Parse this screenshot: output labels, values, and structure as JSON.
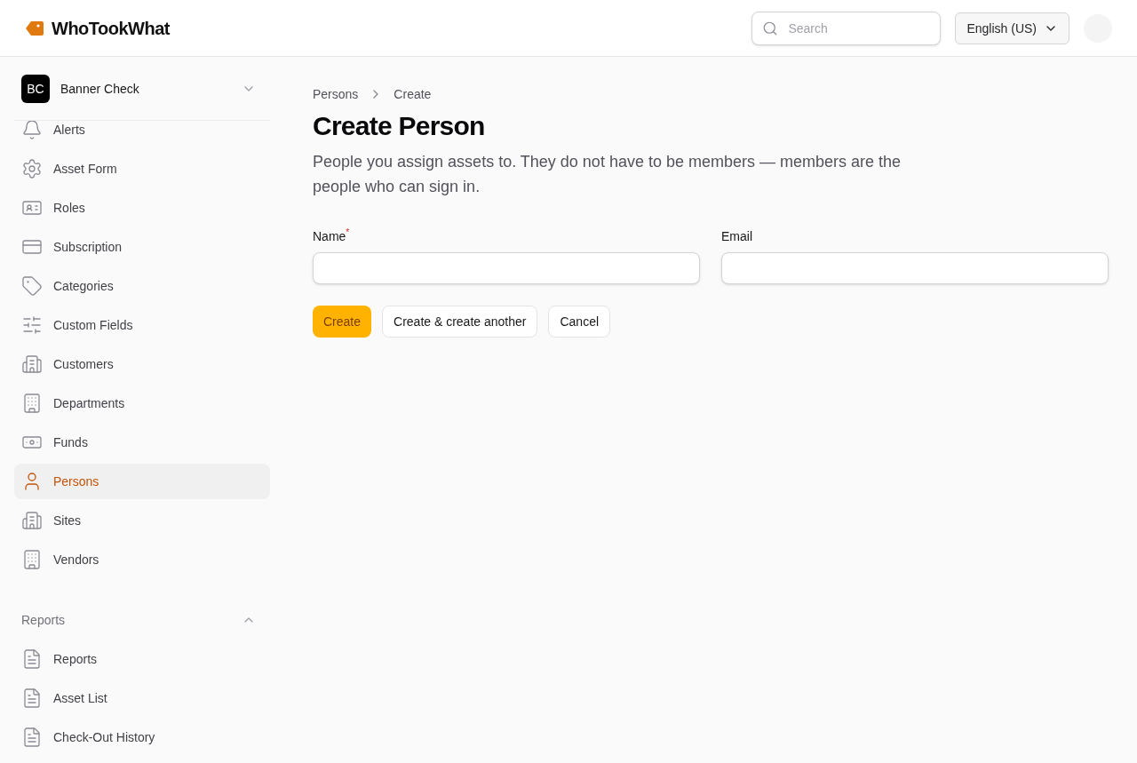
{
  "app": {
    "name": "WhoTookWhat"
  },
  "search": {
    "placeholder": "Search"
  },
  "language": {
    "label": "English (US)"
  },
  "workspace": {
    "initials": "BC",
    "name": "Banner Check"
  },
  "sidebar": {
    "items": [
      {
        "label": "Alerts",
        "selected": false
      },
      {
        "label": "Asset Form",
        "selected": false
      },
      {
        "label": "Roles",
        "selected": false
      },
      {
        "label": "Subscription",
        "selected": false
      },
      {
        "label": "Categories",
        "selected": false
      },
      {
        "label": "Custom Fields",
        "selected": false
      },
      {
        "label": "Customers",
        "selected": false
      },
      {
        "label": "Departments",
        "selected": false
      },
      {
        "label": "Funds",
        "selected": false
      },
      {
        "label": "Persons",
        "selected": true
      },
      {
        "label": "Sites",
        "selected": false
      },
      {
        "label": "Vendors",
        "selected": false
      }
    ],
    "sections": [
      {
        "title": "Reports",
        "expanded": true,
        "items": [
          {
            "label": "Reports",
            "selected": false
          },
          {
            "label": "Asset List",
            "selected": false
          },
          {
            "label": "Check-Out History",
            "selected": false
          }
        ]
      }
    ]
  },
  "breadcrumb": [
    "Persons",
    "Create"
  ],
  "page": {
    "title": "Create Person",
    "description": "People you assign assets to. They do not have to be members — members are the people who can sign in."
  },
  "form": {
    "required_mark": "*",
    "fields": [
      {
        "label": "Name",
        "required": true
      },
      {
        "label": "Email",
        "required": false
      }
    ]
  },
  "buttons": [
    {
      "label": "Create",
      "kind": "primary"
    },
    {
      "label": "Create & create another",
      "kind": "secondary"
    },
    {
      "label": "Cancel",
      "kind": "secondary"
    }
  ]
}
